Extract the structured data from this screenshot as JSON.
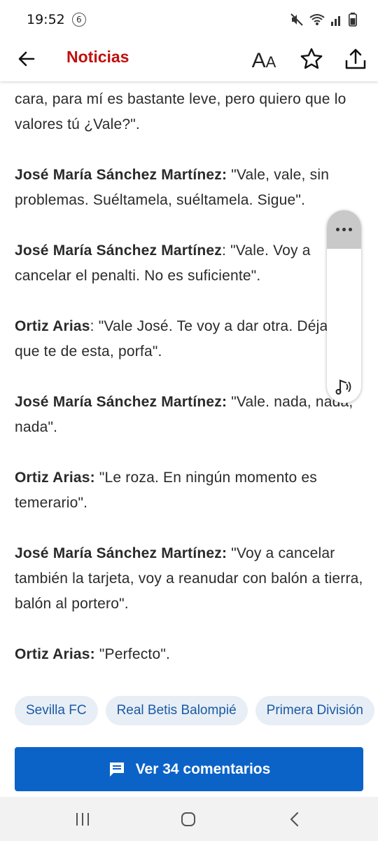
{
  "status_bar": {
    "time": "19:52",
    "notification_count": "6"
  },
  "app_bar": {
    "title": "Noticias",
    "font_size_label_big": "A",
    "font_size_label_small": "A"
  },
  "article": {
    "paragraphs": [
      {
        "speaker": "",
        "text": "cara, para mí es bastante leve, pero quiero que lo valores tú ¿Vale?\"."
      },
      {
        "speaker": "José María Sánchez Martínez:",
        "text": " \"Vale, vale, sin problemas. Suéltamela, suéltamela. Sigue\"."
      },
      {
        "speaker": "José María Sánchez Martínez",
        "text": ": \"Vale. Voy a cancelar el penalti. No es suficiente\"."
      },
      {
        "speaker": "Ortiz Arias",
        "text": ": \"Vale José. Te voy a dar otra. Déjame que te de esta, porfa\"."
      },
      {
        "speaker": "José María Sánchez Martínez:",
        "text": " \"Vale. nada, nada, nada\"."
      },
      {
        "speaker": "Ortiz Arias:",
        "text": " \"Le roza. En ningún momento es temerario\"."
      },
      {
        "speaker": "José María Sánchez Martínez:",
        "text": " \"Voy a cancelar también la tarjeta, voy a reanudar con balón a tierra, balón al portero\"."
      },
      {
        "speaker": "Ortiz Arias:",
        "text": " \"Perfecto\"."
      }
    ]
  },
  "tags": [
    "Sevilla FC",
    "Real Betis Balompié",
    "Primera División"
  ],
  "comments_button": {
    "label": "Ver 34 comentarios"
  },
  "colors": {
    "brand_red": "#c0110f",
    "accent_blue": "#0b63c7",
    "tag_bg": "#e8eef5",
    "tag_text": "#1a5aa6"
  }
}
